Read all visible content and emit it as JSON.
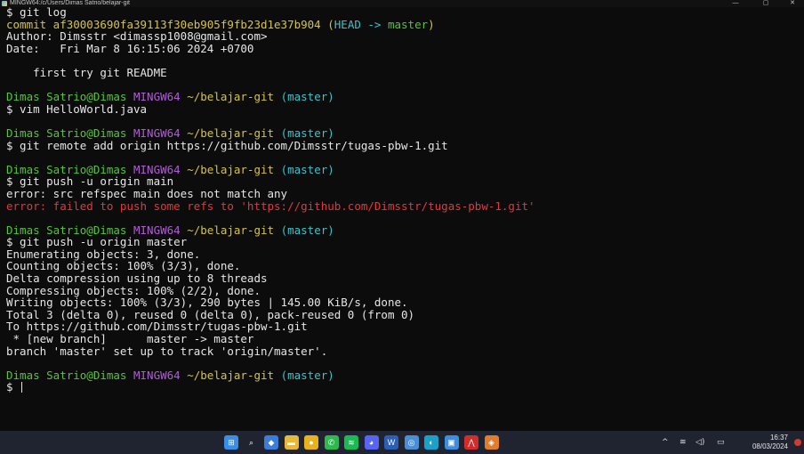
{
  "window": {
    "title": "MINGW64:/c/Users/Dimas Satrio/belajar-git",
    "minimize_glyph": "—",
    "maximize_glyph": "▢",
    "close_glyph": "✕"
  },
  "terminal": {
    "lines": [
      {
        "segments": [
          {
            "text": "$ git log",
            "cls": ""
          }
        ]
      },
      {
        "segments": [
          {
            "text": "commit af30003690fa39113f30eb905f9fb23d1e37b904 ",
            "cls": "yellow"
          },
          {
            "text": "(",
            "cls": "yellow"
          },
          {
            "text": "HEAD -> ",
            "cls": "cyan"
          },
          {
            "text": "master",
            "cls": "green"
          },
          {
            "text": ")",
            "cls": "yellow"
          }
        ]
      },
      {
        "segments": [
          {
            "text": "Author: Dimsstr <dimassp1008@gmail.com>",
            "cls": ""
          }
        ]
      },
      {
        "segments": [
          {
            "text": "Date:   Fri Mar 8 16:15:06 2024 +0700",
            "cls": ""
          }
        ]
      },
      {
        "segments": [
          {
            "text": "",
            "cls": ""
          }
        ]
      },
      {
        "segments": [
          {
            "text": "    first try git README",
            "cls": ""
          }
        ]
      },
      {
        "segments": [
          {
            "text": "",
            "cls": ""
          }
        ]
      },
      {
        "segments": [
          {
            "text": "Dimas Satrio@Dimas ",
            "cls": "green"
          },
          {
            "text": "MINGW64 ",
            "cls": "magenta"
          },
          {
            "text": "~/belajar-git ",
            "cls": "yellow"
          },
          {
            "text": "(master)",
            "cls": "cyan"
          }
        ]
      },
      {
        "segments": [
          {
            "text": "$ vim HelloWorld.java",
            "cls": ""
          }
        ]
      },
      {
        "segments": [
          {
            "text": "",
            "cls": ""
          }
        ]
      },
      {
        "segments": [
          {
            "text": "Dimas Satrio@Dimas ",
            "cls": "green"
          },
          {
            "text": "MINGW64 ",
            "cls": "magenta"
          },
          {
            "text": "~/belajar-git ",
            "cls": "yellow"
          },
          {
            "text": "(master)",
            "cls": "cyan"
          }
        ]
      },
      {
        "segments": [
          {
            "text": "$ git remote add origin https://github.com/Dimsstr/tugas-pbw-1.git",
            "cls": ""
          }
        ]
      },
      {
        "segments": [
          {
            "text": "",
            "cls": ""
          }
        ]
      },
      {
        "segments": [
          {
            "text": "Dimas Satrio@Dimas ",
            "cls": "green"
          },
          {
            "text": "MINGW64 ",
            "cls": "magenta"
          },
          {
            "text": "~/belajar-git ",
            "cls": "yellow"
          },
          {
            "text": "(master)",
            "cls": "cyan"
          }
        ]
      },
      {
        "segments": [
          {
            "text": "$ git push -u origin main",
            "cls": ""
          }
        ]
      },
      {
        "segments": [
          {
            "text": "error: src refspec main does not match any",
            "cls": ""
          }
        ]
      },
      {
        "segments": [
          {
            "text": "error: failed to push some refs to 'https://github.com/Dimsstr/tugas-pbw-1.git'",
            "cls": "red"
          }
        ]
      },
      {
        "segments": [
          {
            "text": "",
            "cls": ""
          }
        ]
      },
      {
        "segments": [
          {
            "text": "Dimas Satrio@Dimas ",
            "cls": "green"
          },
          {
            "text": "MINGW64 ",
            "cls": "magenta"
          },
          {
            "text": "~/belajar-git ",
            "cls": "yellow"
          },
          {
            "text": "(master)",
            "cls": "cyan"
          }
        ]
      },
      {
        "segments": [
          {
            "text": "$ git push -u origin master",
            "cls": ""
          }
        ]
      },
      {
        "segments": [
          {
            "text": "Enumerating objects: 3, done.",
            "cls": ""
          }
        ]
      },
      {
        "segments": [
          {
            "text": "Counting objects: 100% (3/3), done.",
            "cls": ""
          }
        ]
      },
      {
        "segments": [
          {
            "text": "Delta compression using up to 8 threads",
            "cls": ""
          }
        ]
      },
      {
        "segments": [
          {
            "text": "Compressing objects: 100% (2/2), done.",
            "cls": ""
          }
        ]
      },
      {
        "segments": [
          {
            "text": "Writing objects: 100% (3/3), 290 bytes | 145.00 KiB/s, done.",
            "cls": ""
          }
        ]
      },
      {
        "segments": [
          {
            "text": "Total 3 (delta 0), reused 0 (delta 0), pack-reused 0 (from 0)",
            "cls": ""
          }
        ]
      },
      {
        "segments": [
          {
            "text": "To https://github.com/Dimsstr/tugas-pbw-1.git",
            "cls": ""
          }
        ]
      },
      {
        "segments": [
          {
            "text": " * [new branch]      master -> master",
            "cls": ""
          }
        ]
      },
      {
        "segments": [
          {
            "text": "branch 'master' set up to track 'origin/master'.",
            "cls": ""
          }
        ]
      },
      {
        "segments": [
          {
            "text": "",
            "cls": ""
          }
        ]
      },
      {
        "segments": [
          {
            "text": "Dimas Satrio@Dimas ",
            "cls": "green"
          },
          {
            "text": "MINGW64 ",
            "cls": "magenta"
          },
          {
            "text": "~/belajar-git ",
            "cls": "yellow"
          },
          {
            "text": "(master)",
            "cls": "cyan"
          }
        ]
      },
      {
        "segments": [
          {
            "text": "$ ",
            "cls": ""
          }
        ],
        "cursor": true
      }
    ]
  },
  "taskbar": {
    "icons": [
      {
        "name": "start-icon",
        "color": "#3a8ee6",
        "glyph": "⊞"
      },
      {
        "name": "search-icon",
        "color": "transparent",
        "glyph": "⌕"
      },
      {
        "name": "widgets-icon",
        "color": "#3b7dd8",
        "glyph": "◆"
      },
      {
        "name": "file-explorer-icon",
        "color": "#e7b83b",
        "glyph": "▬"
      },
      {
        "name": "chrome-icon",
        "color": "#e8b21d",
        "glyph": "●"
      },
      {
        "name": "whatsapp-icon",
        "color": "#2fb84f",
        "glyph": "✆"
      },
      {
        "name": "spotify-icon",
        "color": "#1db954",
        "glyph": "≋"
      },
      {
        "name": "discord-icon",
        "color": "#5865f2",
        "glyph": "◕"
      },
      {
        "name": "word-icon",
        "color": "#2b5fb4",
        "glyph": "W"
      },
      {
        "name": "steam-icon",
        "color": "#4a8fd6",
        "glyph": "◎"
      },
      {
        "name": "edge-icon",
        "color": "#1ba0c9",
        "glyph": "◐"
      },
      {
        "name": "store-icon",
        "color": "#3b8fe0",
        "glyph": "▣"
      },
      {
        "name": "acrobat-icon",
        "color": "#d42b2b",
        "glyph": "⋀"
      },
      {
        "name": "git-bash-icon",
        "color": "#e07c2a",
        "glyph": "◈"
      }
    ],
    "tray": {
      "chevron_glyph": "^",
      "wifi_glyph": "≋",
      "volume_glyph": "◁)",
      "battery_glyph": "▭",
      "time": "16:37",
      "date": "08/03/2024"
    }
  }
}
